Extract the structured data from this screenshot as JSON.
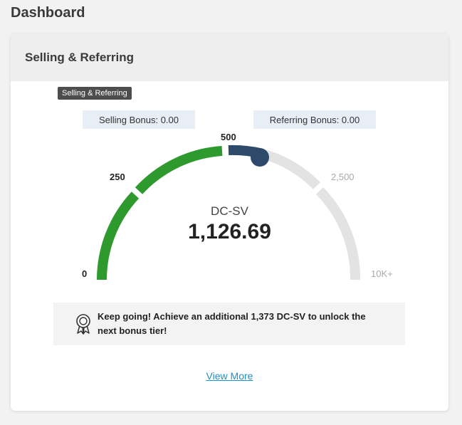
{
  "page": {
    "title": "Dashboard"
  },
  "card": {
    "title": "Selling & Referring",
    "tooltip": "Selling & Referring",
    "selling_bonus": "Selling Bonus: 0.00",
    "referring_bonus": "Referring Bonus: 0.00",
    "message": "Keep going! Achieve an additional 1,373 DC-SV to unlock the next bonus tier!",
    "view_more": "View More"
  },
  "gauge": {
    "label": "DC-SV",
    "value_text": "1,126.69",
    "value": 1126.69,
    "ticks": [
      "0",
      "250",
      "500",
      "2,500",
      "10K+"
    ],
    "colors": {
      "achieved": "#2e9a2e",
      "current": "#2e4a6b",
      "remaining": "#e3e3e3"
    }
  }
}
